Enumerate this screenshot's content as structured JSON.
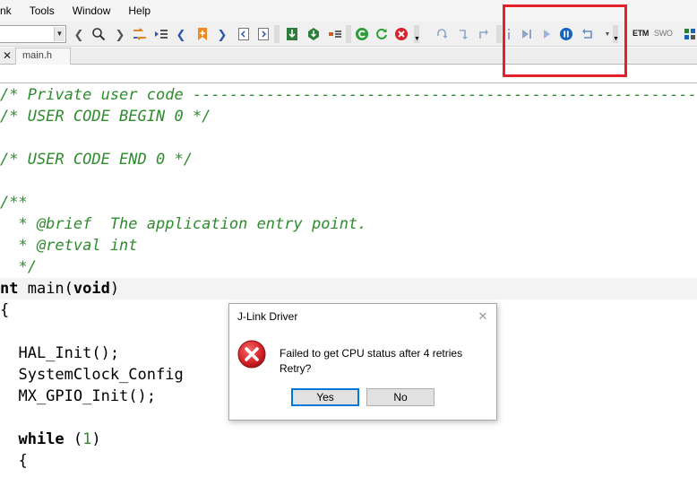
{
  "menu": {
    "items": [
      "nk",
      "Tools",
      "Window",
      "Help"
    ]
  },
  "toolbar": {
    "etm_label": "ETM",
    "swo_label": "SWO"
  },
  "tabs": {
    "close_glyph": "✕",
    "active_tab": "main.h"
  },
  "code": {
    "lines": [
      {
        "kind": "comment",
        "text": "/* Private user code ---------------------------------------------------------"
      },
      {
        "kind": "comment",
        "text": "/* USER CODE BEGIN 0 */"
      },
      {
        "kind": "blank",
        "text": ""
      },
      {
        "kind": "comment",
        "text": "/* USER CODE END 0 */"
      },
      {
        "kind": "blank",
        "text": ""
      },
      {
        "kind": "comment",
        "text": "/**"
      },
      {
        "kind": "comment",
        "text": "  * @brief  The application entry point."
      },
      {
        "kind": "comment",
        "text": "  * @retval int"
      },
      {
        "kind": "comment",
        "text": "  */"
      },
      {
        "kind": "code",
        "parts": [
          {
            "t": "nt",
            "c": "kw"
          },
          {
            "t": " main(",
            "c": ""
          },
          {
            "t": "void",
            "c": "kw"
          },
          {
            "t": ")",
            "c": ""
          }
        ]
      },
      {
        "kind": "code",
        "parts": [
          {
            "t": "{",
            "c": ""
          }
        ]
      },
      {
        "kind": "blank",
        "text": ""
      },
      {
        "kind": "code",
        "parts": [
          {
            "t": "  HAL_Init();",
            "c": ""
          }
        ]
      },
      {
        "kind": "code",
        "parts": [
          {
            "t": "  SystemClock_Config",
            "c": ""
          }
        ]
      },
      {
        "kind": "code",
        "parts": [
          {
            "t": "  MX_GPIO_Init();",
            "c": ""
          }
        ]
      },
      {
        "kind": "blank",
        "text": ""
      },
      {
        "kind": "code",
        "parts": [
          {
            "t": "  ",
            "c": ""
          },
          {
            "t": "while",
            "c": "kw"
          },
          {
            "t": " (",
            "c": ""
          },
          {
            "t": "1",
            "c": "num"
          },
          {
            "t": ")",
            "c": ""
          }
        ]
      },
      {
        "kind": "code",
        "parts": [
          {
            "t": "  {",
            "c": ""
          }
        ]
      }
    ]
  },
  "dialog": {
    "title": "J-Link Driver",
    "message_line1": "Failed to get CPU status after 4 retries",
    "message_line2": "Retry?",
    "yes_label": "Yes",
    "no_label": "No"
  },
  "colors": {
    "highlight_box": "#e4202a",
    "comment": "#2e8b2e",
    "error_icon": "#d8232a"
  }
}
